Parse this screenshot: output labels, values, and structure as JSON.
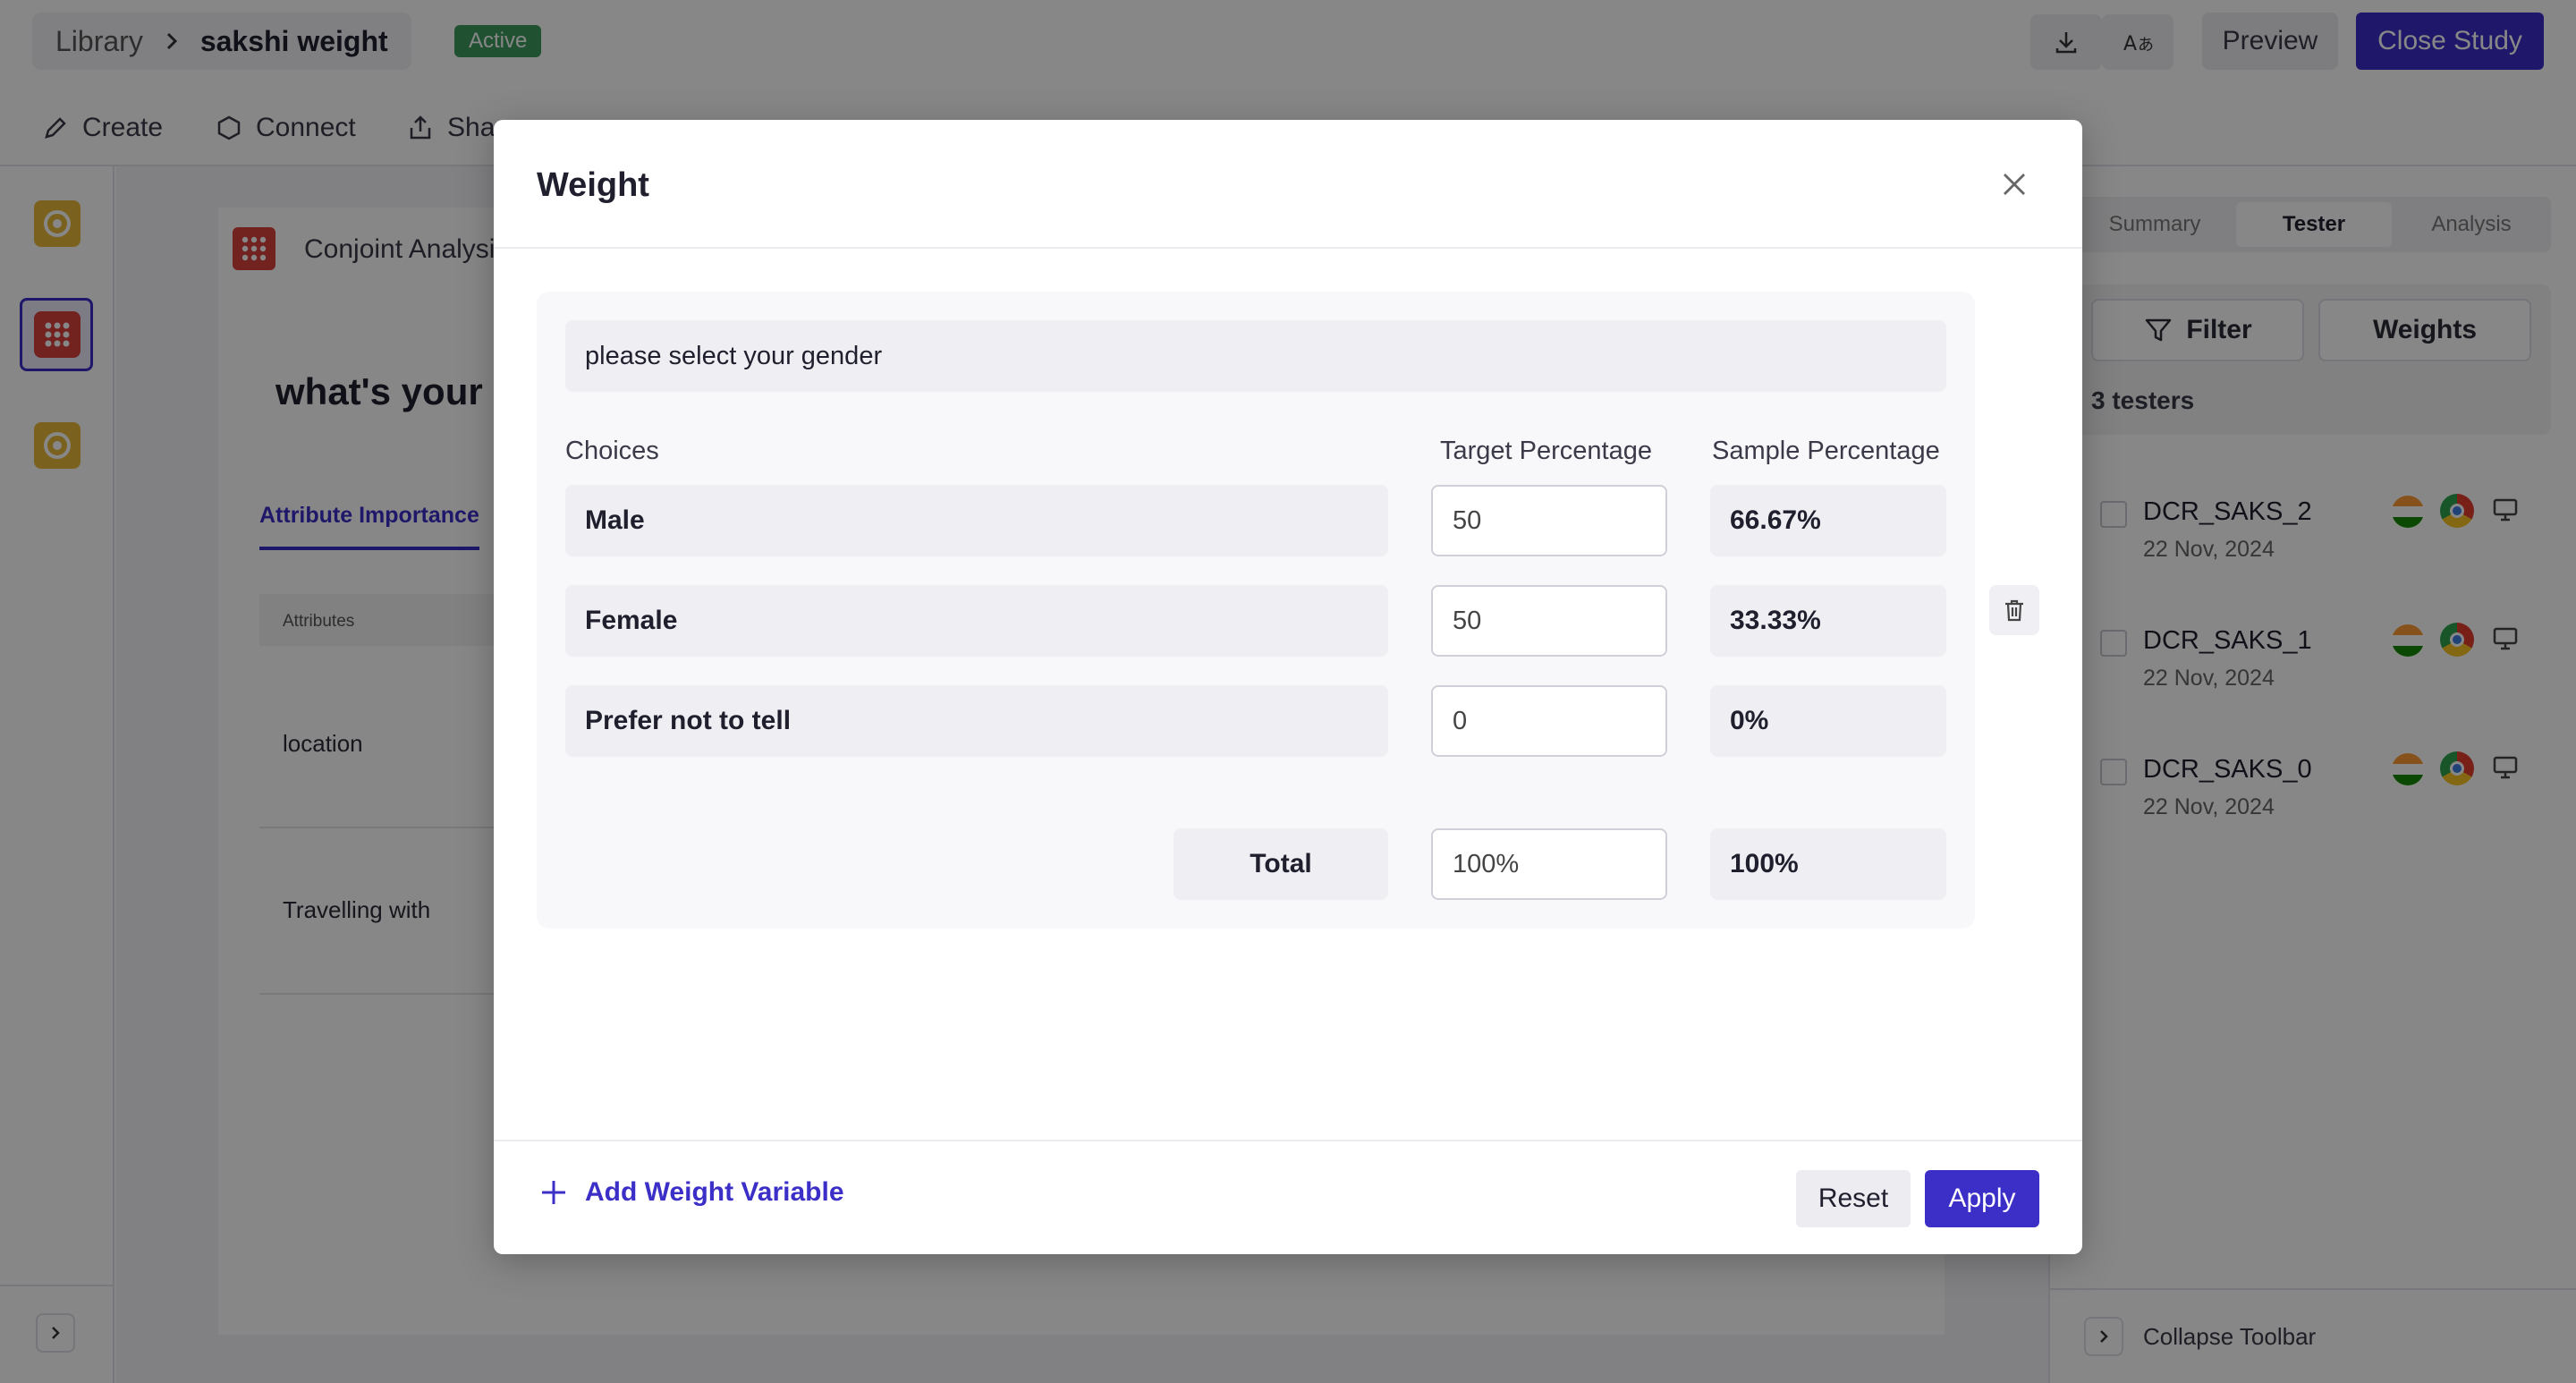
{
  "header": {
    "breadcrumb_root": "Library",
    "breadcrumb_current": "sakshi weight",
    "status_badge": "Active",
    "preview_label": "Preview",
    "close_study_label": "Close Study"
  },
  "toolbar": {
    "create": "Create",
    "connect": "Connect",
    "share": "Sha"
  },
  "main": {
    "section_label": "Conjoint Analysi",
    "question_title": "what's your p",
    "tab_label": "Attribute Importance",
    "table_header": "Attributes",
    "rows": [
      "location",
      "Travelling with"
    ]
  },
  "right_panel": {
    "tabs": [
      "Summary",
      "Tester",
      "Analysis"
    ],
    "active_tab": "Tester",
    "filter_label": "Filter",
    "weights_label": "Weights",
    "testers_count": "3 testers",
    "testers": [
      {
        "name": "DCR_SAKS_2",
        "date": "22 Nov, 2024"
      },
      {
        "name": "DCR_SAKS_1",
        "date": "22 Nov, 2024"
      },
      {
        "name": "DCR_SAKS_0",
        "date": "22 Nov, 2024"
      }
    ],
    "collapse_label": "Collapse Toolbar"
  },
  "modal": {
    "title": "Weight",
    "question": "please select your gender",
    "col_choices": "Choices",
    "col_target": "Target Percentage",
    "col_sample": "Sample Percentage",
    "choices": [
      {
        "label": "Male",
        "target": "50",
        "sample": "66.67%"
      },
      {
        "label": "Female",
        "target": "50",
        "sample": "33.33%"
      },
      {
        "label": "Prefer not to tell",
        "target": "0",
        "sample": "0%"
      }
    ],
    "total_label": "Total",
    "total_target": "100%",
    "total_sample": "100%",
    "add_variable_label": "Add Weight Variable",
    "reset_label": "Reset",
    "apply_label": "Apply"
  },
  "colors": {
    "accent": "#3c2fc8",
    "active_badge": "#3d9a5d"
  }
}
